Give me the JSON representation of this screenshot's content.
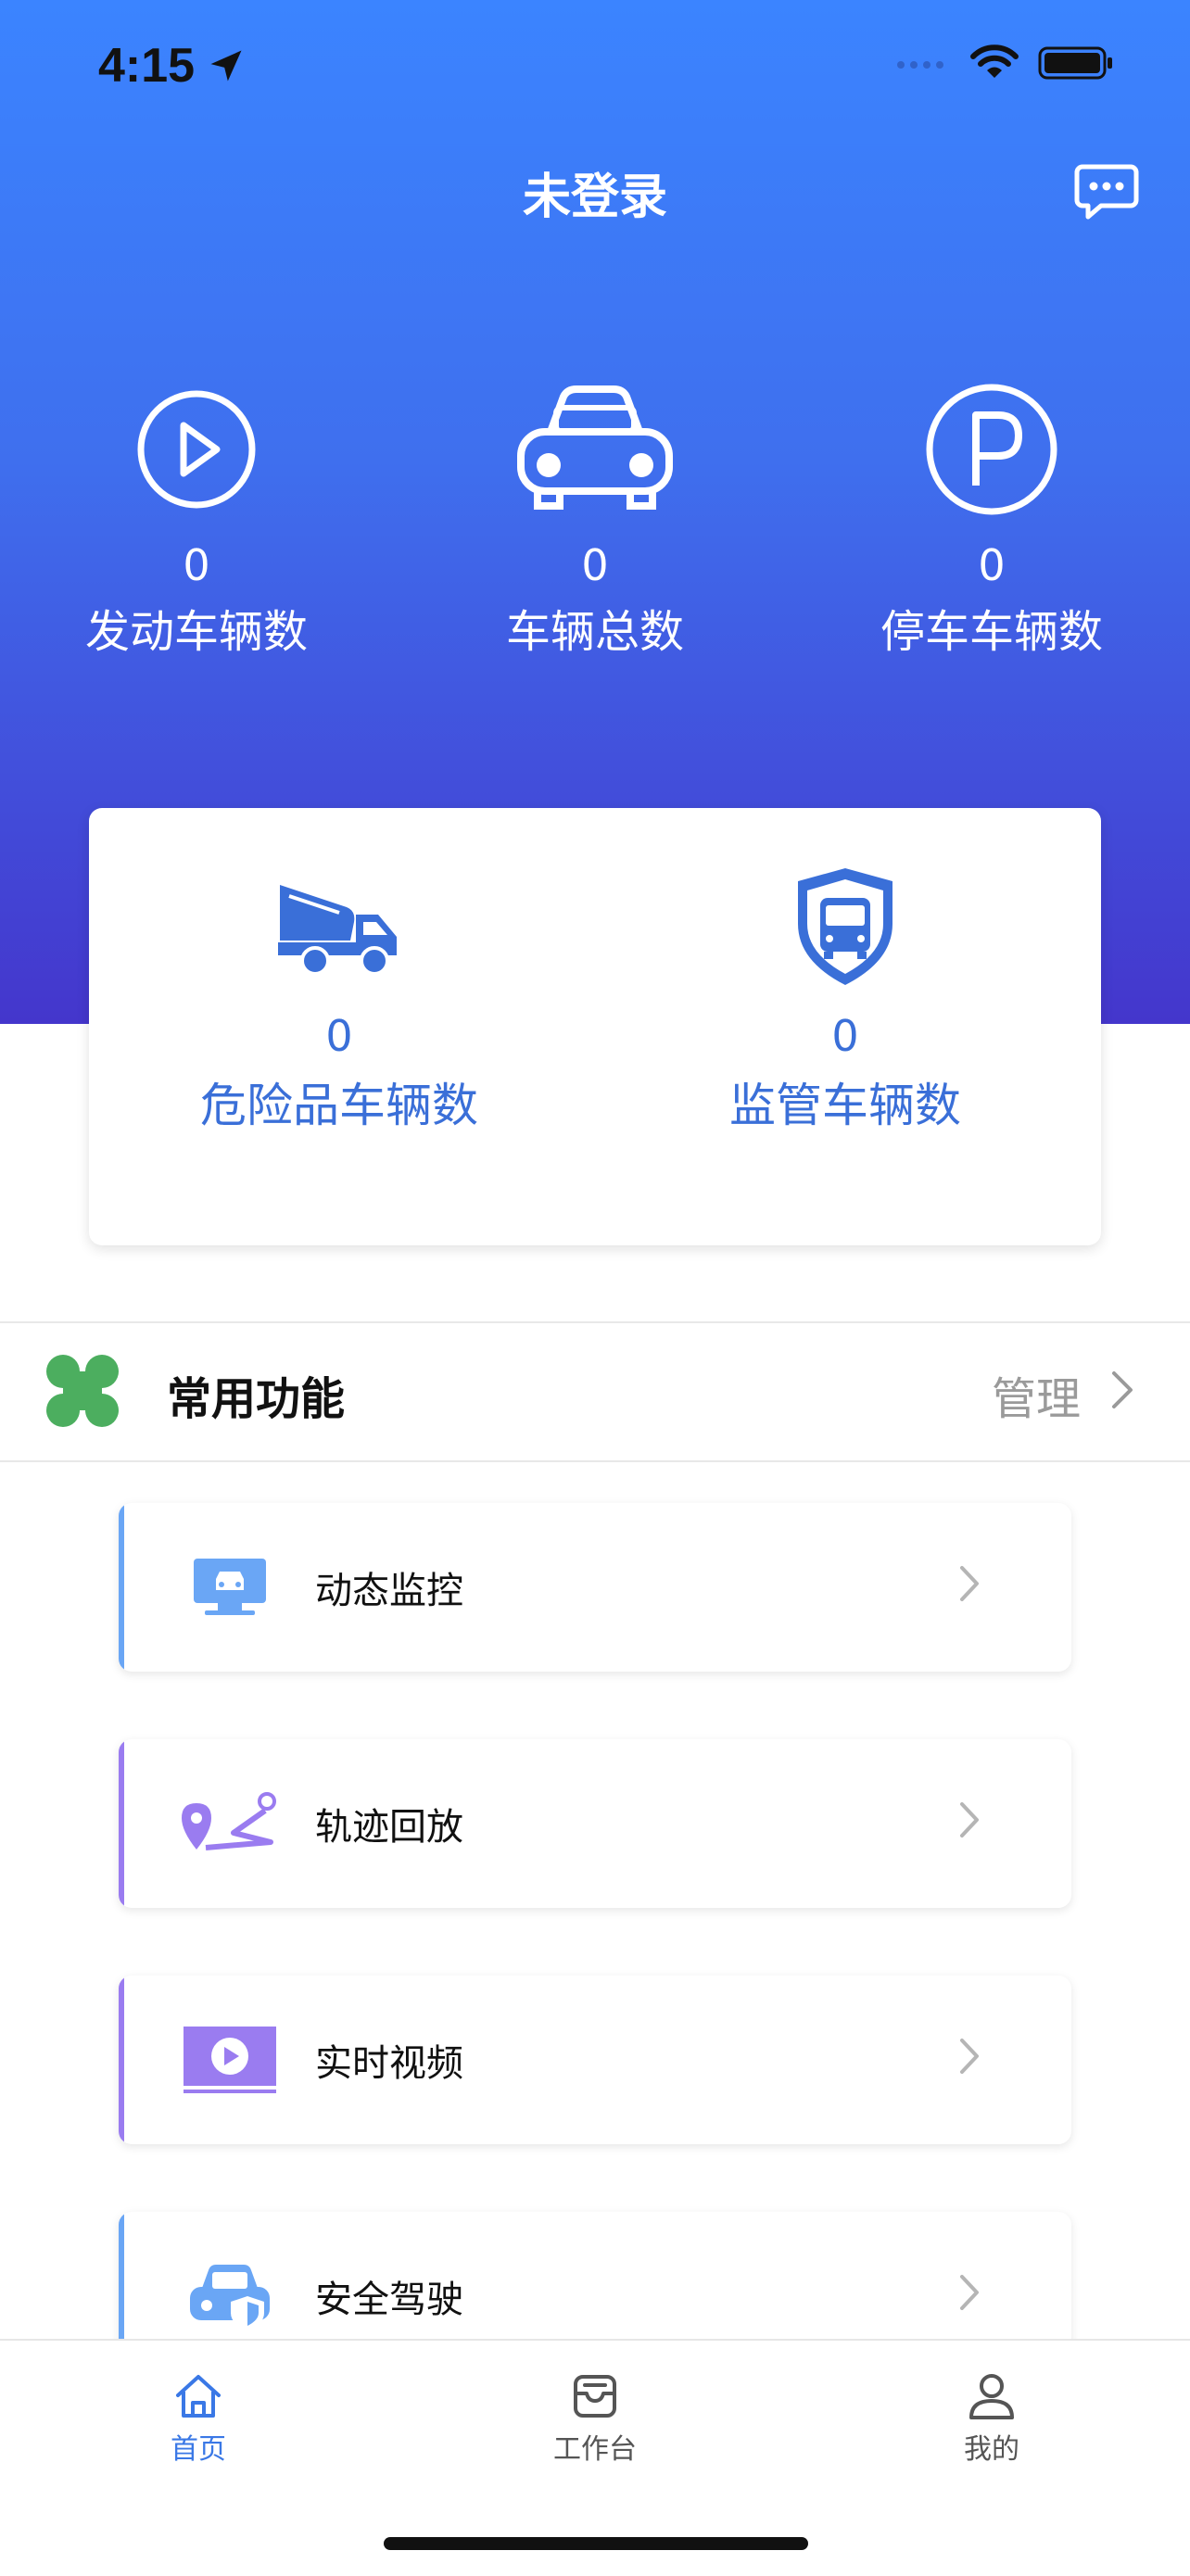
{
  "status_bar": {
    "time": "4:15"
  },
  "header": {
    "title": "未登录"
  },
  "stats": [
    {
      "value": "0",
      "label": "发动车辆数",
      "icon": "play-circle-icon"
    },
    {
      "value": "0",
      "label": "车辆总数",
      "icon": "car-icon"
    },
    {
      "value": "0",
      "label": "停车车辆数",
      "icon": "parking-icon"
    }
  ],
  "special_stats": [
    {
      "value": "0",
      "label": "危险品车辆数",
      "icon": "tanker-truck-icon"
    },
    {
      "value": "0",
      "label": "监管车辆数",
      "icon": "shield-bus-icon"
    }
  ],
  "functions": {
    "title": "常用功能",
    "manage_label": "管理",
    "items": [
      {
        "label": "动态监控",
        "icon": "monitor-icon",
        "accent": "#6aa6f5"
      },
      {
        "label": "轨迹回放",
        "icon": "track-icon",
        "accent": "#9a7cf0"
      },
      {
        "label": "实时视频",
        "icon": "video-icon",
        "accent": "#9a7cf0"
      },
      {
        "label": "安全驾驶",
        "icon": "safe-car-icon",
        "accent": "#6aa6f5"
      }
    ]
  },
  "tabs": [
    {
      "label": "首页",
      "icon": "home-icon",
      "active": true
    },
    {
      "label": "工作台",
      "icon": "inbox-icon",
      "active": false
    },
    {
      "label": "我的",
      "icon": "user-icon",
      "active": false
    }
  ],
  "colors": {
    "header_top": "#3b84ff",
    "header_bottom": "#4436cc",
    "accent_blue": "#3a6fd8",
    "tab_active": "#3a78e6",
    "tab_inactive": "#555555"
  }
}
